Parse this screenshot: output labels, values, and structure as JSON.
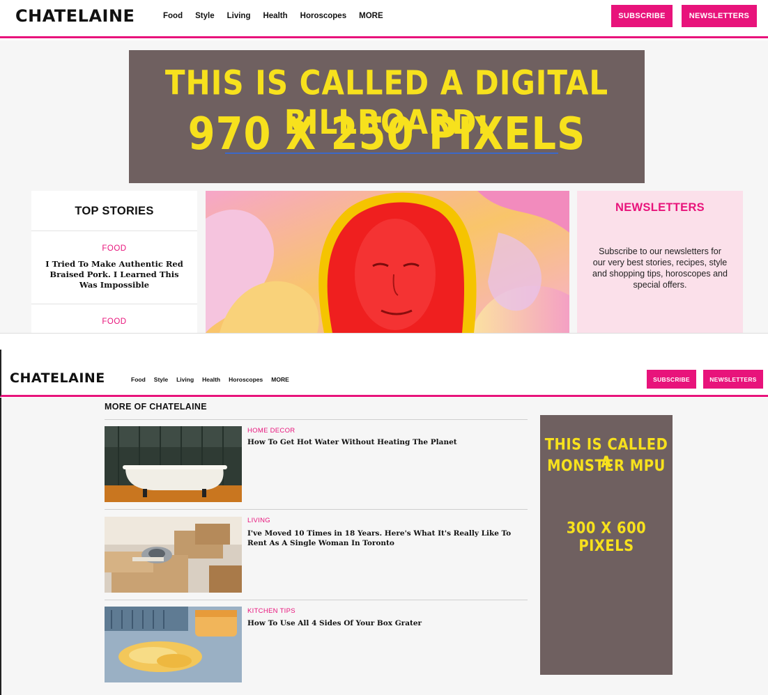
{
  "header": {
    "logo": "CHATELAINE",
    "nav": [
      "Food",
      "Style",
      "Living",
      "Health",
      "Horoscopes",
      "MORE"
    ],
    "subscribe": "SUBSCRIBE",
    "newsletters": "NEWSLETTERS"
  },
  "billboard": {
    "line1": "THIS IS CALLED A DIGITAL BILLBOARD:",
    "line2": "970 X 250 PIXELS"
  },
  "top_stories": {
    "title": "TOP STORIES",
    "items": [
      {
        "category": "FOOD",
        "headline": "I Tried To Make Authentic Red Braised Pork. I Learned This Was Impossible"
      },
      {
        "category": "FOOD",
        "headline": ""
      }
    ]
  },
  "newsletters_box": {
    "title": "NEWSLETTERS",
    "body": "Subscribe to our newsletters for our very best stories, recipes, style and shopping tips, horoscopes and special offers."
  },
  "more": {
    "title": "MORE OF CHATELAINE",
    "articles": [
      {
        "category": "HOME DECOR",
        "headline": "How To Get Hot Water Without Heating The Planet",
        "image": "clawfoot-bathtub"
      },
      {
        "category": "LIVING",
        "headline": "I've Moved 10 Times in 18 Years. Here's What It's Really Like To Rent As A Single Woman In Toronto",
        "image": "moving-boxes"
      },
      {
        "category": "KITCHEN TIPS",
        "headline": "How To Use All 4 Sides Of Your Box Grater",
        "image": "shredded-cheese"
      }
    ]
  },
  "mpu": {
    "line1": "THIS IS CALLED A",
    "line2": "MONSTER MPU",
    "line3": "300 X 600 PIXELS"
  },
  "colors": {
    "accent": "#e8137b",
    "ad_background": "#6f6060",
    "ad_text": "#f7e11d"
  }
}
